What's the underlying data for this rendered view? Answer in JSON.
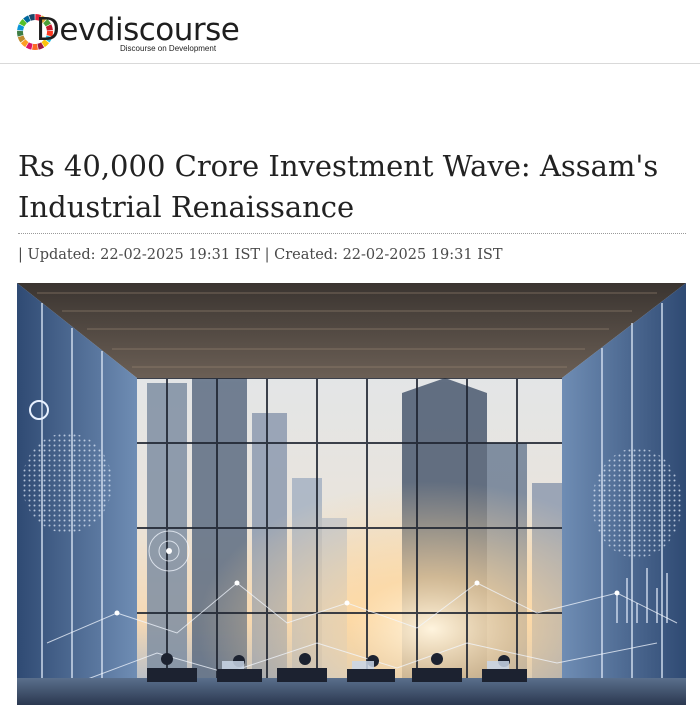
{
  "header": {
    "logo_text": "Devdiscourse",
    "logo_tagline": "Discourse on Development",
    "logo_colors": [
      "#e5243b",
      "#dda63a",
      "#4c9f38",
      "#c5192d",
      "#ff3a21",
      "#26bde2",
      "#fcc30b",
      "#a21942",
      "#fd6925",
      "#dd1367",
      "#fd9d24",
      "#bf8b2e",
      "#3f7e44",
      "#0a97d9",
      "#56c02b",
      "#00689d",
      "#19486a"
    ]
  },
  "article": {
    "title": "Rs 40,000 Crore Investment Wave: Assam's Industrial Renaissance",
    "meta": "| Updated: 22-02-2025 19:31 IST | Created: 22-02-2025 19:31 IST"
  },
  "hero_image": {
    "description_icon": "image-icon"
  }
}
